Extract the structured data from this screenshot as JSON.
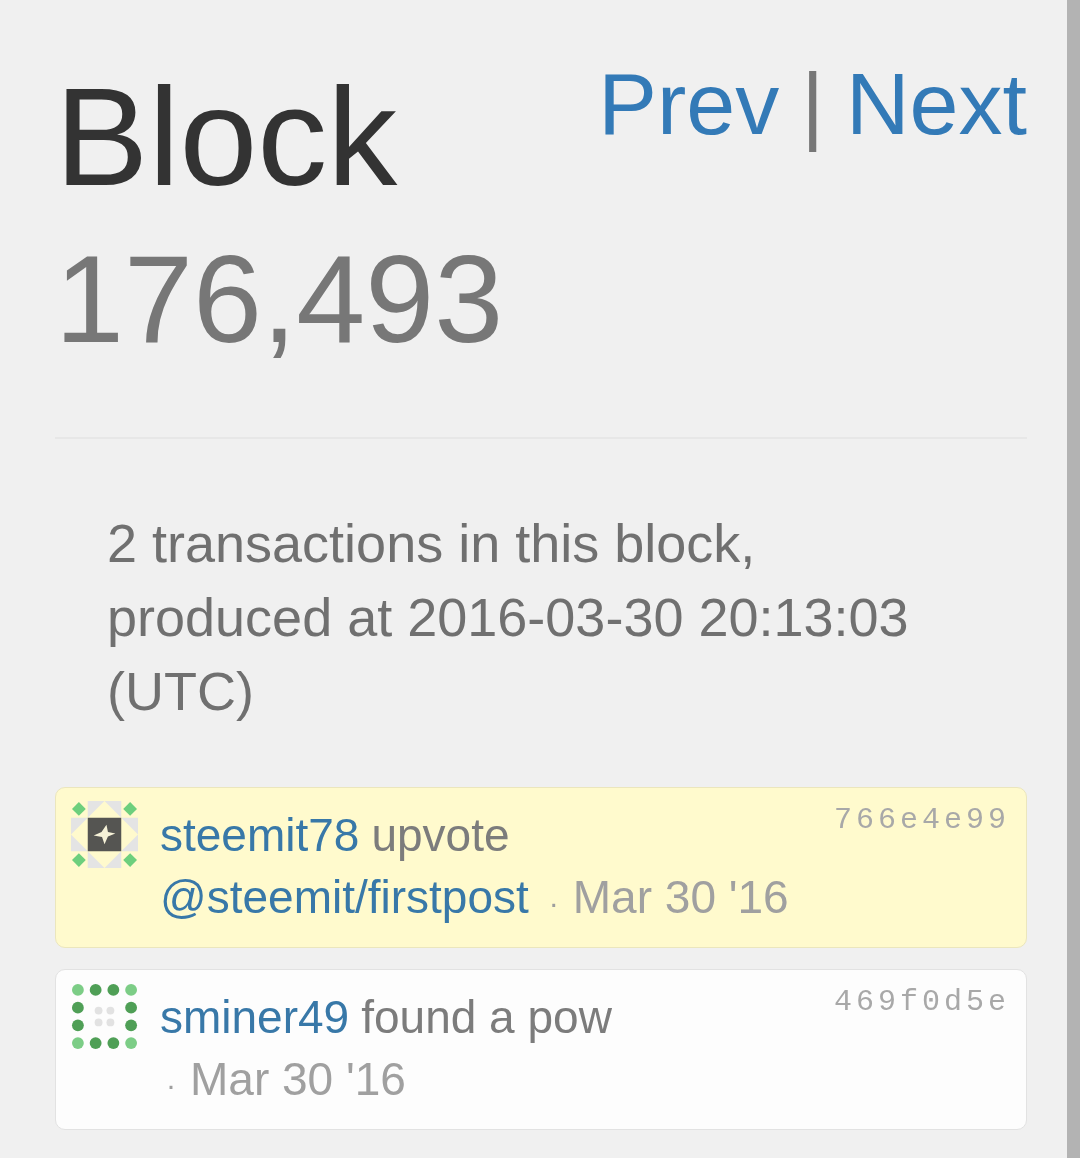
{
  "header": {
    "title": "Block",
    "block_number": "176,493",
    "nav": [
      {
        "label": "Prev"
      },
      {
        "label": "Next"
      }
    ],
    "separator": "|"
  },
  "summary": "2 transactions in this block, produced at 2016-03-30 20:13:03 (UTC)",
  "transactions": [
    {
      "kind": "vote",
      "actor": "steemit78",
      "action": "upvote",
      "target": "@steemit/firstpost",
      "separator": "·",
      "time": "Mar 30 '16",
      "hash": "766e4e99"
    },
    {
      "kind": "pow",
      "actor": "sminer49",
      "action": "found a pow",
      "separator": "·",
      "time": "Mar 30 '16",
      "hash": "469f0d5e"
    }
  ]
}
